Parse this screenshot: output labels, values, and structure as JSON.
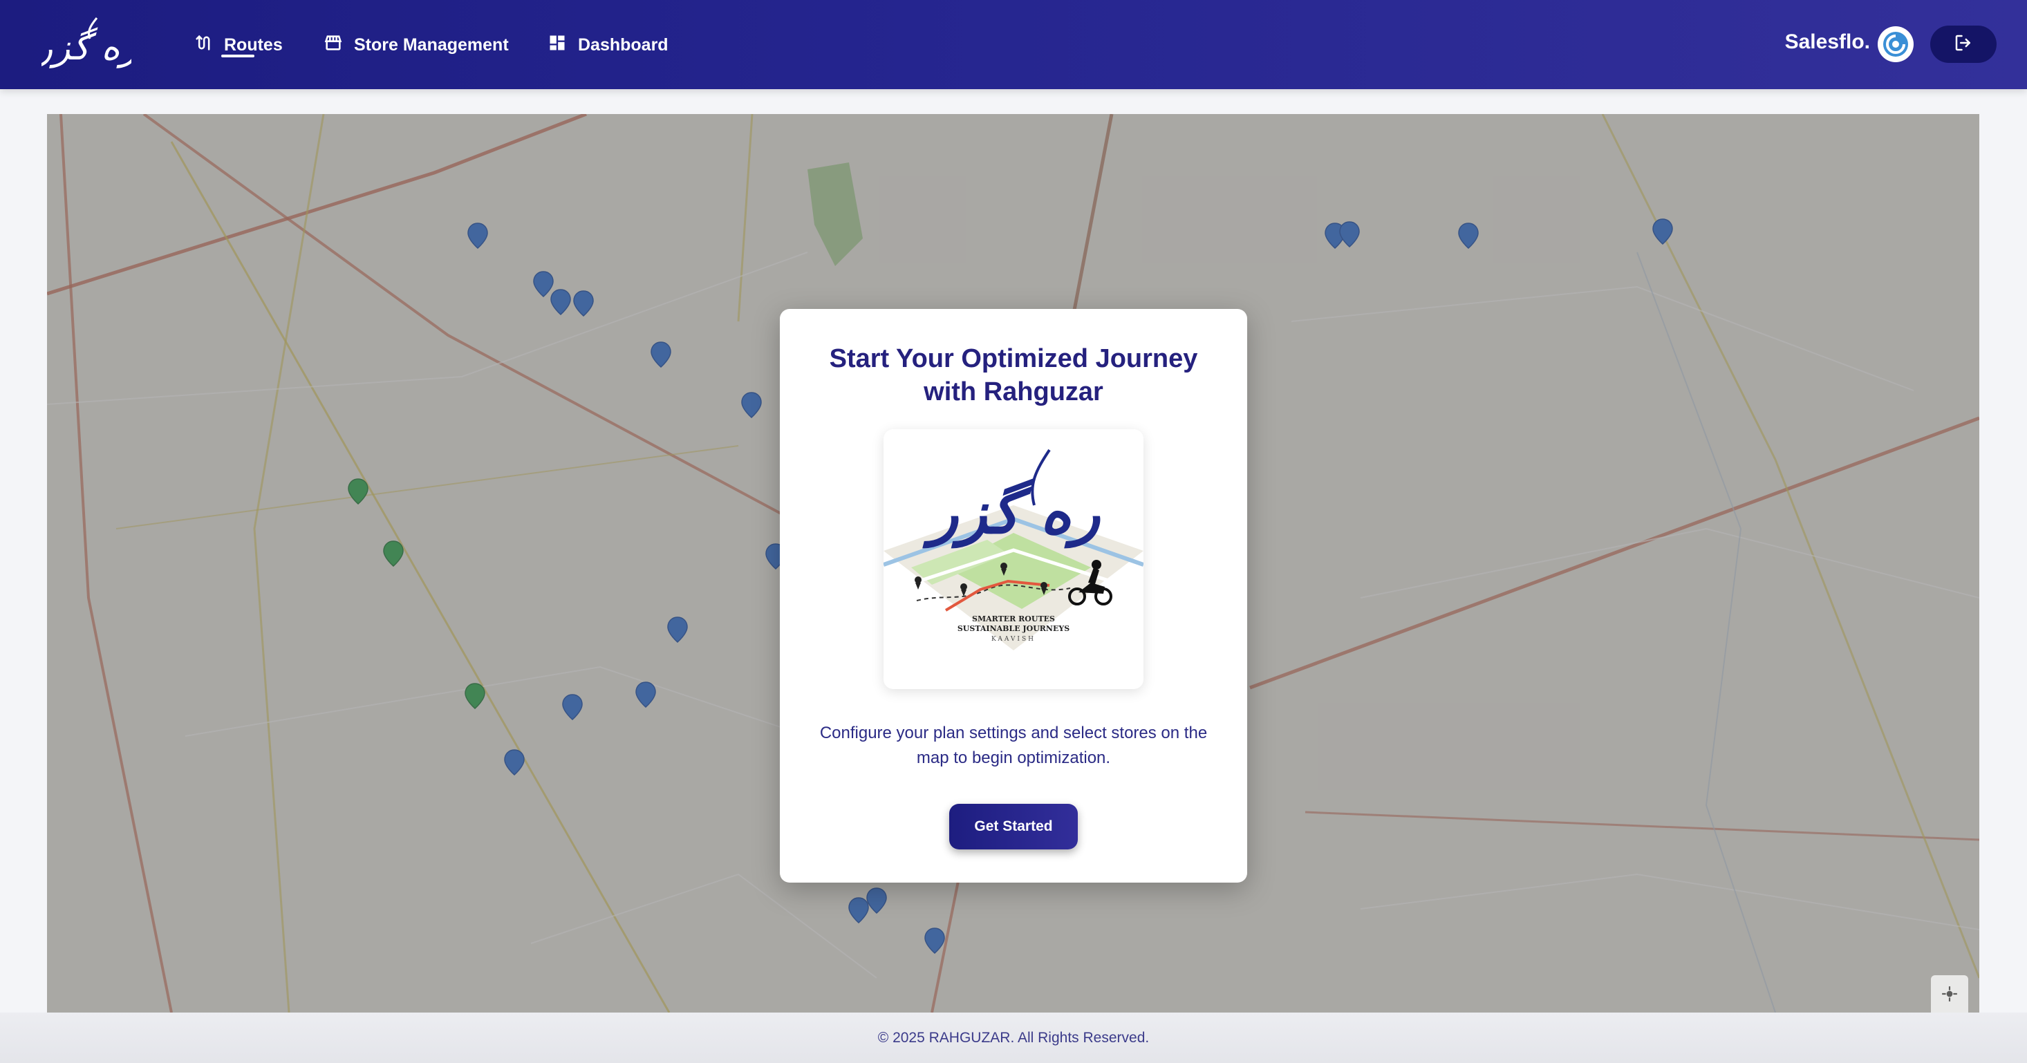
{
  "brand": {
    "logo_text": "ره گزر"
  },
  "nav": {
    "items": [
      {
        "label": "Routes",
        "icon": "route-icon",
        "active": true
      },
      {
        "label": "Store Management",
        "icon": "store-icon",
        "active": false
      },
      {
        "label": "Dashboard",
        "icon": "dashboard-icon",
        "active": false
      }
    ]
  },
  "header": {
    "company_name": "Salesflo.",
    "company_icon": "company-logo-icon",
    "logout_icon": "logout-icon"
  },
  "map": {
    "locate_icon": "crosshair-icon",
    "colors": {
      "store_marker": "#2f6fd6",
      "selected_marker": "#2fa84f",
      "highway": "#e07a5f",
      "road": "#d9c964"
    }
  },
  "modal": {
    "title": "Start Your Optimized Journey with Rahguzar",
    "image": {
      "logo_text": "ره گزر",
      "tagline_1": "SMARTER ROUTES",
      "tagline_2": "SUSTAINABLE JOURNEYS",
      "tagline_3": "KAAVISH"
    },
    "description": "Configure your plan settings and select stores on the map to begin optimization.",
    "button_label": "Get Started"
  },
  "footer": {
    "text": "© 2025 RAHGUZAR. All Rights Reserved."
  },
  "theme": {
    "primary": "#25217e",
    "nav_bg": "#1c1c80",
    "logout_bg": "#141466"
  }
}
